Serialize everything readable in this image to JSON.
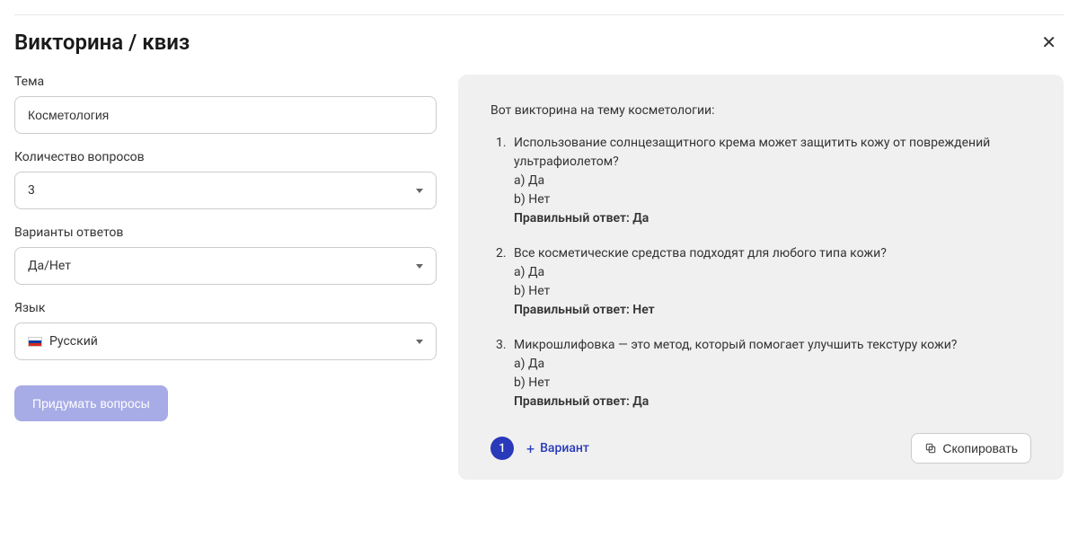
{
  "header": {
    "title": "Викторина / квиз"
  },
  "form": {
    "topic": {
      "label": "Тема",
      "value": "Косметология"
    },
    "numQuestions": {
      "label": "Количество вопросов",
      "value": "3"
    },
    "answerVariants": {
      "label": "Варианты ответов",
      "value": "Да/Нет"
    },
    "language": {
      "label": "Язык",
      "value": "Русский"
    },
    "generateLabel": "Придумать вопросы"
  },
  "output": {
    "intro": "Вот викторина на тему косметологии:",
    "questions": [
      {
        "text": "Использование солнцезащитного крема может защитить кожу от повреждений ультрафиолетом?",
        "optA": "a) Да",
        "optB": "b) Нет",
        "answer": "Правильный ответ: Да"
      },
      {
        "text": "Все косметические средства подходят для любого типа кожи?",
        "optA": "a) Да",
        "optB": "b) Нет",
        "answer": "Правильный ответ: Нет"
      },
      {
        "text": "Микрошлифовка — это метод, который помогает улучшить текстуру кожи?",
        "optA": "a) Да",
        "optB": "b) Нет",
        "answer": "Правильный ответ: Да"
      }
    ],
    "pageNumber": "1",
    "variantLabel": "Вариант",
    "copyLabel": "Скопировать"
  }
}
